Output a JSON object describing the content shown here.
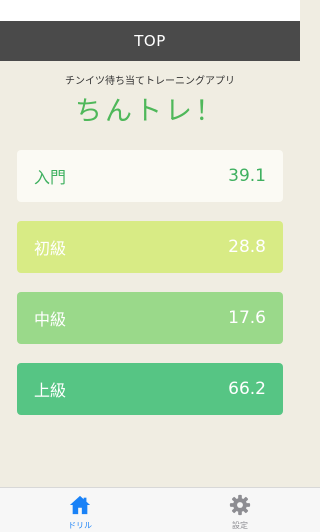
{
  "nav": {
    "title": "TOP"
  },
  "header": {
    "subtitle": "チンイツ待ち当てトレーニングアプリ",
    "app_title": "ちんトレ！"
  },
  "levels": [
    {
      "name": "入門",
      "score": "39.1"
    },
    {
      "name": "初級",
      "score": "28.8"
    },
    {
      "name": "中級",
      "score": "17.6"
    },
    {
      "name": "上級",
      "score": "66.2"
    }
  ],
  "tabs": [
    {
      "label": "ドリル",
      "icon": "home-icon",
      "active": true
    },
    {
      "label": "設定",
      "icon": "gear-icon",
      "active": false
    }
  ],
  "colors": {
    "nav_bg": "#4a4a4a",
    "page_bg": "#f0ede2",
    "title_green": "#4fb85a",
    "level_beginner": "#fbfaf4",
    "level_novice": "#d8eb85",
    "level_middle": "#9ad98a",
    "level_advanced": "#56c584",
    "tab_active": "#1a82f7",
    "tab_inactive": "#8e8e93"
  }
}
